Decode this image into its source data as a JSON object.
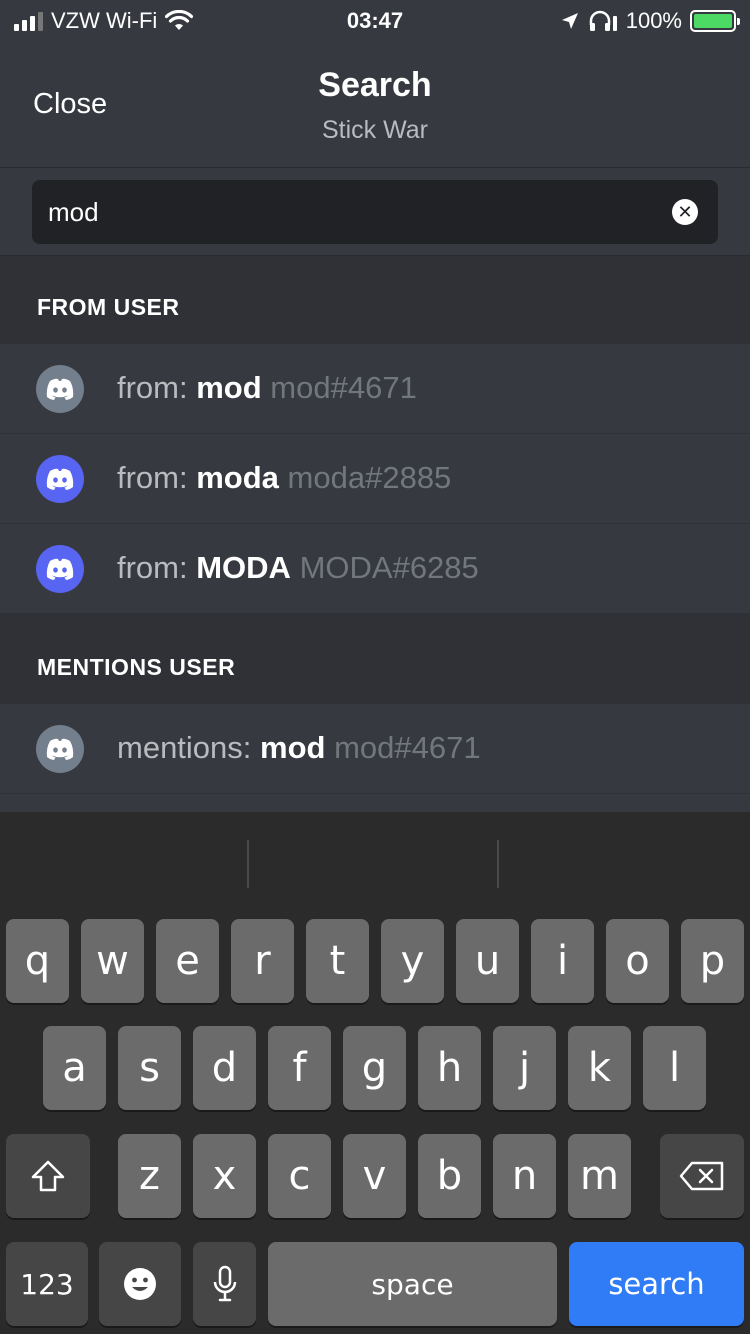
{
  "status_bar": {
    "carrier": "VZW Wi-Fi",
    "time": "03:47",
    "battery": "100%"
  },
  "header": {
    "close": "Close",
    "title": "Search",
    "subtitle": "Stick War"
  },
  "search": {
    "value": "mod",
    "clear_icon": "clear-icon"
  },
  "sections": [
    {
      "title": "FROM USER",
      "rows": [
        {
          "prefix": "from: ",
          "name": "mod",
          "tag": "mod#4671",
          "avatar_color": "#747f8d"
        },
        {
          "prefix": "from: ",
          "name": "moda",
          "tag": "moda#2885",
          "avatar_color": "#5865f2"
        },
        {
          "prefix": "from: ",
          "name": "MODA",
          "tag": "MODA#6285",
          "avatar_color": "#5865f2"
        }
      ]
    },
    {
      "title": "MENTIONS USER",
      "rows": [
        {
          "prefix": "mentions: ",
          "name": "mod",
          "tag": "mod#4671",
          "avatar_color": "#747f8d"
        }
      ]
    }
  ],
  "keyboard": {
    "row1": [
      "q",
      "w",
      "e",
      "r",
      "t",
      "y",
      "u",
      "i",
      "o",
      "p"
    ],
    "row2": [
      "a",
      "s",
      "d",
      "f",
      "g",
      "h",
      "j",
      "k",
      "l"
    ],
    "row3": [
      "z",
      "x",
      "c",
      "v",
      "b",
      "n",
      "m"
    ],
    "numbers_key": "123",
    "space_key": "space",
    "search_key": "search",
    "shift_icon": "shift-icon",
    "delete_icon": "delete-icon",
    "emoji_icon": "emoji-icon",
    "mic_icon": "microphone-icon"
  },
  "colors": {
    "background": "#36393f",
    "section_header": "#2f3136",
    "search_box": "#202225",
    "blurple": "#5865f2",
    "grey_avatar": "#747f8d",
    "search_key": "#2f7cf6",
    "battery_green": "#4cd964"
  }
}
